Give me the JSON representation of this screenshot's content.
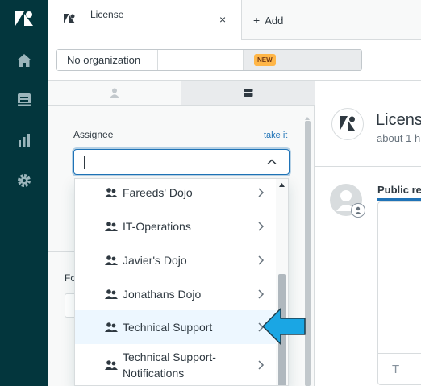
{
  "nav": {
    "items": [
      "zendesk-logo",
      "home",
      "views",
      "reporting",
      "admin"
    ]
  },
  "tabs": {
    "active_title": "License",
    "close_glyph": "×",
    "add_label": "Add"
  },
  "org_bar": {
    "organization": "No organization",
    "badge": "NEW"
  },
  "panel": {
    "assignee_label": "Assignee",
    "take_it": "take it",
    "assignee_value": "",
    "fo_label": "Fo"
  },
  "dropdown": {
    "items": [
      {
        "label": "Fareeds' Dojo"
      },
      {
        "label": "IT-Operations"
      },
      {
        "label": "Javier's Dojo"
      },
      {
        "label": "Jonathans Dojo"
      },
      {
        "label": "Technical Support",
        "highlighted": true
      },
      {
        "label_line1": "Technical Support-",
        "label_line2": "Notifications"
      }
    ]
  },
  "ticket": {
    "title": "Licens",
    "subtitle": "about 1 h",
    "reply_tab": "Public re",
    "toolbar_t": "T"
  },
  "colors": {
    "rail": "#03363d",
    "accent": "#1f73b7",
    "callout": "#1aa6e4",
    "badge": "#ffb648"
  }
}
